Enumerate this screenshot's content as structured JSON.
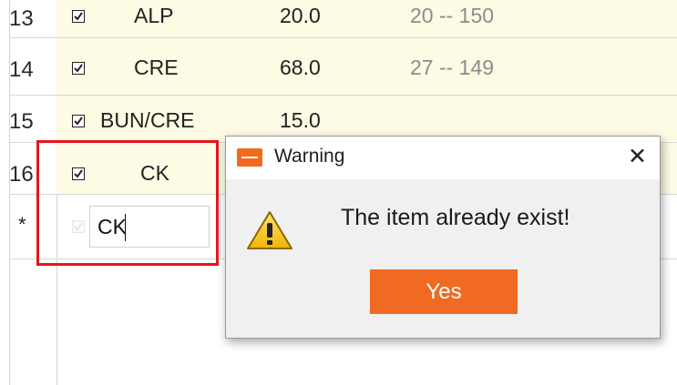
{
  "grid": {
    "rows": [
      {
        "num": "13",
        "item": "ALP",
        "value": "20.0",
        "range": "20 -- 150"
      },
      {
        "num": "14",
        "item": "CRE",
        "value": "68.0",
        "range": "27 -- 149"
      },
      {
        "num": "15",
        "item": "BUN/CRE",
        "value": "15.0",
        "range": ""
      },
      {
        "num": "16",
        "item": "CK",
        "value": "",
        "range": ""
      }
    ],
    "new_row_marker": "*",
    "new_row_input": "CK"
  },
  "dialog": {
    "title": "Warning",
    "message": "The item already exist!",
    "yes_label": "Yes",
    "close_glyph": "✕",
    "icon": "warning-icon",
    "accent_color": "#f06a22"
  },
  "highlight_color": "#e8141c"
}
